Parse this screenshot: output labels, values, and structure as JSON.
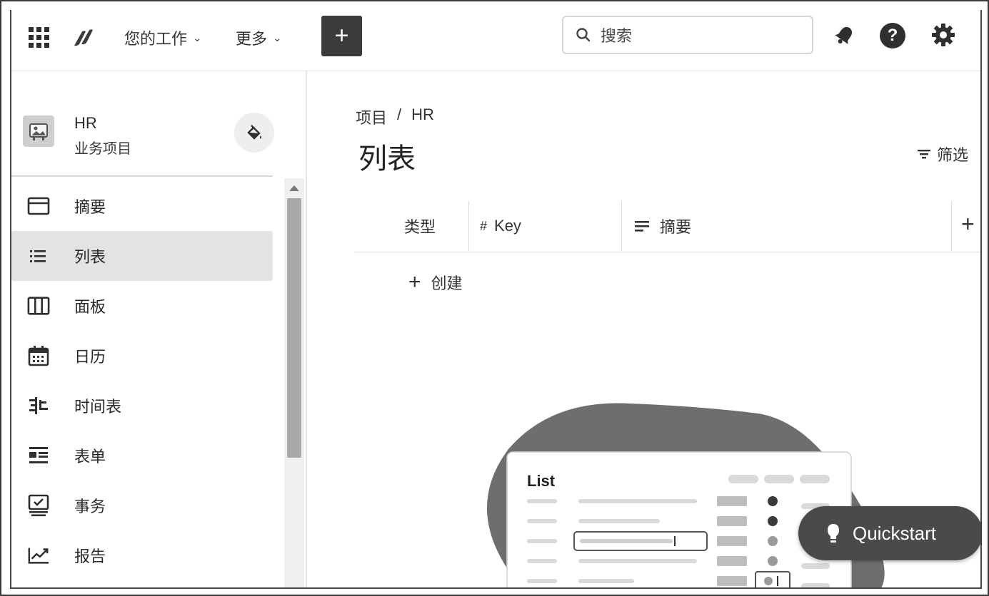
{
  "topbar": {
    "your_work_label": "您的工作",
    "more_label": "更多",
    "create_label": "+",
    "search_placeholder": "搜索",
    "help_label": "?"
  },
  "sidebar": {
    "project_name": "HR",
    "project_type": "业务项目",
    "items": [
      {
        "label": "摘要",
        "icon": "summary-icon"
      },
      {
        "label": "列表",
        "icon": "list-icon",
        "active": true
      },
      {
        "label": "面板",
        "icon": "board-icon"
      },
      {
        "label": "日历",
        "icon": "calendar-icon"
      },
      {
        "label": "时间表",
        "icon": "timeline-icon"
      },
      {
        "label": "表单",
        "icon": "form-icon"
      },
      {
        "label": "事务",
        "icon": "issues-icon"
      },
      {
        "label": "报告",
        "icon": "reports-icon"
      }
    ]
  },
  "main": {
    "breadcrumb": [
      "项目",
      "/",
      "HR"
    ],
    "title": "列表",
    "filter_label": "筛选",
    "columns": {
      "type": "类型",
      "key_prefix": "#",
      "key": "Key",
      "summary": "摘要"
    },
    "create_label": "创建",
    "illustration_title": "List",
    "quickstart_label": "Quickstart"
  },
  "colors": {
    "accent": "#3b3b3b",
    "active_item_bg": "#e3e3e3",
    "blob": "#6e6e6e"
  }
}
